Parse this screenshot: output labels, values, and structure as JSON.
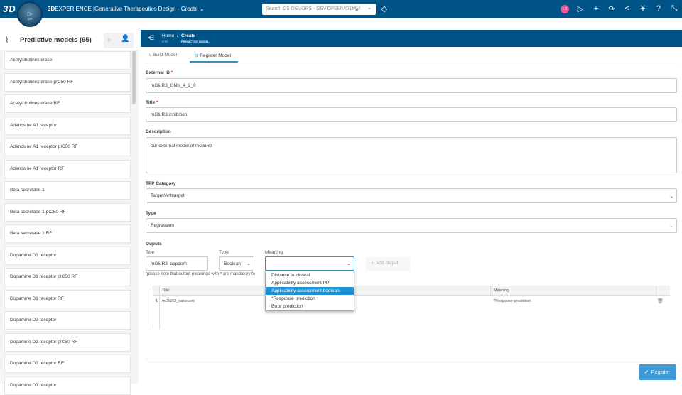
{
  "topbar": {
    "brand_bold": "3D",
    "brand_rest": "EXPERIENCE",
    "app_title": "Generative Therapeutics Design - Create",
    "search_placeholder": "Search DS DEVOPS - DEVOPSMMO1MM",
    "compass_label": "V,R",
    "compass_left": "3D",
    "avatar_initials": "LB"
  },
  "left": {
    "title": "Predictive models (95)",
    "items": [
      "Acetylcholinesterase",
      "Acetylcholinesterase pIC50 RF",
      "Acetylcholinesterase RF",
      "Adenosine A1 receptor",
      "Adenosine A1 receptor pIC50 RF",
      "Adenosine A1 receptor RF",
      "Beta secretase 1",
      "Beta secretase 1 pIC50 RF",
      "Beta secretase 1 RF",
      "Dopamine D1 receptor",
      "Dopamine D1 receptor pIC50 RF",
      "Dopamine D1 receptor RF",
      "Dopamine D2 receptor",
      "Dopamine D2 receptor pIC50 RF",
      "Dopamine D2 receptor RF",
      "Dopamine D3 receptor"
    ]
  },
  "breadcrumb": {
    "home": "Home",
    "home_sub": "GTD",
    "current": "Create",
    "current_sub": "PREDICTIVE MODEL"
  },
  "tabs": [
    {
      "label": "Build Model"
    },
    {
      "label": "Register Model"
    }
  ],
  "form": {
    "external_id": {
      "label": "External ID",
      "value": "mGluR3_GNN_4_2_0"
    },
    "title": {
      "label": "Title",
      "value": "mGluR3 inhibition"
    },
    "description": {
      "label": "Description",
      "value": "our external model of mGluR3"
    },
    "tpp": {
      "label": "TPP Category",
      "value": "Target/Antitarget"
    },
    "type": {
      "label": "Type",
      "value": "Regression"
    },
    "outputs": {
      "label": "Ouputs",
      "title_label": "Title",
      "type_label": "Type",
      "meaning_label": "Meaning",
      "title_value": "mGluR3_appdom",
      "type_value": "Boolean",
      "meaning_value": "",
      "add_label": "Add output",
      "note": "(please note that output meanings with * are mandatory fo",
      "options": [
        "Distance to closest",
        "Applicability assessment PP",
        "Applicability assessment boolean",
        "*Response prediction",
        "Error prediction"
      ],
      "table": {
        "headers": [
          "Title",
          "Meaning"
        ],
        "rows": [
          {
            "n": "1",
            "title": "mGluR3_calcscore",
            "meaning": "*Response prediction"
          }
        ]
      }
    },
    "register_label": "Register"
  }
}
